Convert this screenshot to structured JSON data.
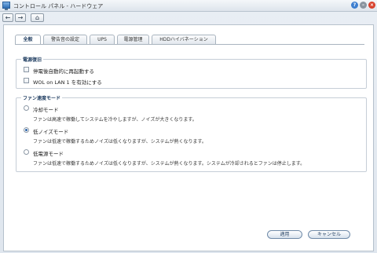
{
  "window": {
    "title": "コントロール パネル - ハードウェア",
    "help_symbol": "?",
    "minimize_symbol": "–",
    "close_symbol": "×"
  },
  "nav": {
    "back_symbol": "←",
    "forward_symbol": "→",
    "home_symbol": "⌂"
  },
  "tabs": [
    {
      "label": "全般",
      "active": true
    },
    {
      "label": "警告音の設定",
      "active": false
    },
    {
      "label": "UPS",
      "active": false
    },
    {
      "label": "電源管理",
      "active": false
    },
    {
      "label": "HDDハイバネーション",
      "active": false
    }
  ],
  "power_recovery": {
    "title": "電源復旧",
    "options": [
      {
        "label": "停電後自動的に再起動する",
        "checked": false
      },
      {
        "label": "WOL on LAN 1 を有効にする",
        "checked": false
      }
    ]
  },
  "fan_mode": {
    "title": "ファン速度モード",
    "options": [
      {
        "label": "冷却モード",
        "selected": false,
        "description": "ファンは高速で稼働してシステムを冷やしますが、ノイズが大きくなります。"
      },
      {
        "label": "低ノイズモード",
        "selected": true,
        "description": "ファンは低速で稼働するためノイズは低くなりますが、システムが熱くなります。"
      },
      {
        "label": "低電源モード",
        "selected": false,
        "description": "ファンは低速で稼働するためノイズは低くなりますが、システムが熱くなります。システムが冷却されるとファンは停止します。"
      }
    ]
  },
  "buttons": {
    "apply": "適用",
    "cancel": "キャンセル"
  },
  "colors": {
    "accent": "#2b63a8",
    "close": "#d8412c",
    "help": "#3d7fd0"
  }
}
